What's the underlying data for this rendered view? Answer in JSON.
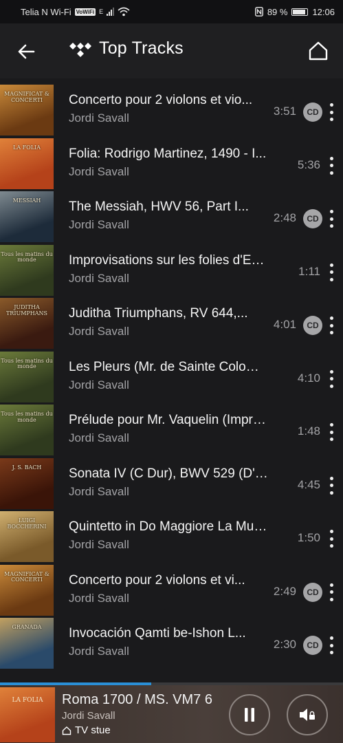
{
  "status": {
    "carrier": "Telia N Wi-Fi",
    "volte": "VoWiFi",
    "network": "E",
    "battery": "89 %",
    "time": "12:06"
  },
  "header": {
    "title": "Top Tracks",
    "back_icon": "arrow-left-icon",
    "logo_icon": "tidal-logo-icon",
    "home_icon": "home-icon"
  },
  "tracks": [
    {
      "title": "Concerto pour 2 violons et vio...",
      "artist": "Jordi Savall",
      "duration": "3:51",
      "cd": true,
      "cover_text": "MAGNIFICAT & CONCERTI",
      "cover_colors": [
        "#6b3a12",
        "#c98a3a"
      ]
    },
    {
      "title": "Folia: Rodrigo Martinez, 1490 - I...",
      "artist": "Jordi Savall",
      "duration": "5:36",
      "cd": false,
      "cover_text": "LA FOLIA",
      "cover_colors": [
        "#b5421a",
        "#e0823a"
      ]
    },
    {
      "title": "The Messiah, HWV 56, Part I...",
      "artist": "Jordi Savall",
      "duration": "2:48",
      "cd": true,
      "cover_text": "MESSIAH",
      "cover_colors": [
        "#1d2b3a",
        "#7f8a90"
      ]
    },
    {
      "title": "Improvisations sur les folies d'Esp...",
      "artist": "Jordi Savall",
      "duration": "1:11",
      "cd": false,
      "cover_text": "Tous les matins du monde",
      "cover_colors": [
        "#2f3a1e",
        "#6b7a3a"
      ]
    },
    {
      "title": "Juditha Triumphans, RV 644,...",
      "artist": "Jordi Savall",
      "duration": "4:01",
      "cd": true,
      "cover_text": "JUDITHA TRIUMPHANS",
      "cover_colors": [
        "#3a1a10",
        "#8a5a2a"
      ]
    },
    {
      "title": "Les Pleurs (Mr. de Sainte Colomb...",
      "artist": "Jordi Savall",
      "duration": "4:10",
      "cd": false,
      "cover_text": "Tous les matins du monde",
      "cover_colors": [
        "#2f3a1e",
        "#6b7a3a"
      ]
    },
    {
      "title": "Prélude pour Mr. Vaquelin (Improv...",
      "artist": "Jordi Savall",
      "duration": "1:48",
      "cd": false,
      "cover_text": "Tous les matins du monde",
      "cover_colors": [
        "#2f3a1e",
        "#6b7a3a"
      ]
    },
    {
      "title": "Sonata IV (C Dur), BWV 529 (D'a...",
      "artist": "Jordi Savall",
      "duration": "4:45",
      "cd": false,
      "cover_text": "J. S. BACH",
      "cover_colors": [
        "#3a1408",
        "#7a3a1a"
      ]
    },
    {
      "title": "Quintetto in Do Maggiore La Musi...",
      "artist": "Jordi Savall",
      "duration": "1:50",
      "cd": false,
      "cover_text": "LUIGI BOCCHERINI",
      "cover_colors": [
        "#7a5a2a",
        "#d0b070"
      ]
    },
    {
      "title": "Concerto pour 2 violons et vi...",
      "artist": "Jordi Savall",
      "duration": "2:49",
      "cd": true,
      "cover_text": "MAGNIFICAT & CONCERTI",
      "cover_colors": [
        "#6b3a12",
        "#c98a3a"
      ]
    },
    {
      "title": "Invocación Qamti be-Ishon L...",
      "artist": "Jordi Savall",
      "duration": "2:30",
      "cd": true,
      "cover_text": "GRANADA",
      "cover_colors": [
        "#2a4a6a",
        "#c2a060"
      ]
    }
  ],
  "cd_label": "CD",
  "player": {
    "title": "Roma 1700 / MS. VM7 6",
    "artist": "Jordi Savall",
    "device": "TV stue",
    "progress": 0.44,
    "pause_icon": "pause-icon",
    "volume_icon": "speaker-lock-icon",
    "cover_colors": [
      "#b5421a",
      "#e0823a"
    ]
  }
}
